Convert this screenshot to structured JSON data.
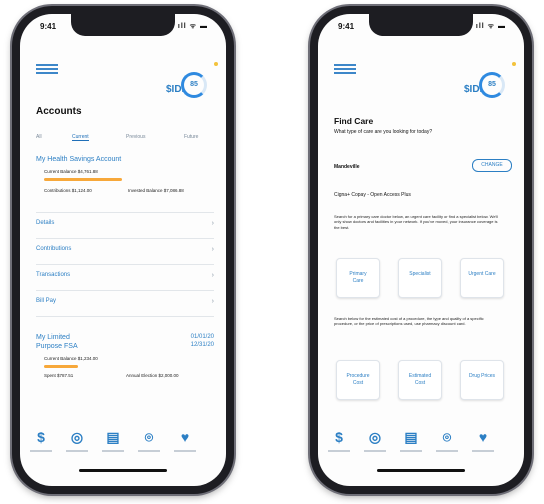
{
  "accent": "#2c7fc4",
  "bar_color": "#f7a83a",
  "left": {
    "status": {
      "time": "9:41",
      "icons": "ıll ᯤ ▬"
    },
    "ring_label": "85",
    "card_label": "$IDI",
    "title": "Accounts",
    "tabs": [
      "All",
      "Current",
      "Previous",
      "Future"
    ],
    "hsa": {
      "title": "My Health Savings Account",
      "current_balance": "Current Balance $4,761.88",
      "contributions": "Contributions $1,124.00",
      "invest_balance": "Invested Balance $7,086.88"
    },
    "menu": [
      "Details",
      "Contributions",
      "Transactions",
      "Bill Pay"
    ],
    "fsa": {
      "title_line1": "My Limited",
      "title_line2": "Purpose FSA",
      "date1": "01/01/20",
      "date2": "12/31/20",
      "current_balance": "Current Balance $1,234.00",
      "available": "Spent $787.51",
      "annual_election": "Annual Election $2,000.00"
    },
    "tabbar_icons": [
      "dollar-icon",
      "piggybank-icon",
      "clipboard-icon",
      "location-icon",
      "care-icon"
    ],
    "tabbar_glyphs": [
      "$",
      "◎",
      "▤",
      "⌾",
      "♥"
    ]
  },
  "right": {
    "status": {
      "time": "9:41",
      "icons": "ıll ᯤ ▬"
    },
    "ring_label": "85",
    "card_label": "$IDI",
    "title": "Find Care",
    "question": "What type of care are you looking for today?",
    "location": "Mandeville",
    "change_label": "CHANGE",
    "plan": "Cigna+ Copay - Open Access Plus",
    "para1": "Search for a primary care doctor below, an urgent care facility or find a specialist below. We'll only show doctors and facilities in your network. If you've moved, your insurance coverage is the best.",
    "cards1": [
      {
        "line1": "Primary",
        "line2": "Care"
      },
      {
        "line1": "Specialist",
        "line2": ""
      },
      {
        "line1": "Urgent Care",
        "line2": ""
      }
    ],
    "para2": "Search below for the estimated cost of a procedure, the type and quality of a specific procedure, or the price of prescriptions used, use pharmacy discount card.",
    "cards2": [
      {
        "line1": "Procedure",
        "line2": "Cost"
      },
      {
        "line1": "Estimated",
        "line2": "Cost"
      },
      {
        "line1": "Drug Prices",
        "line2": ""
      }
    ],
    "tabbar_glyphs": [
      "$",
      "◎",
      "▤",
      "⌾",
      "♥"
    ]
  }
}
